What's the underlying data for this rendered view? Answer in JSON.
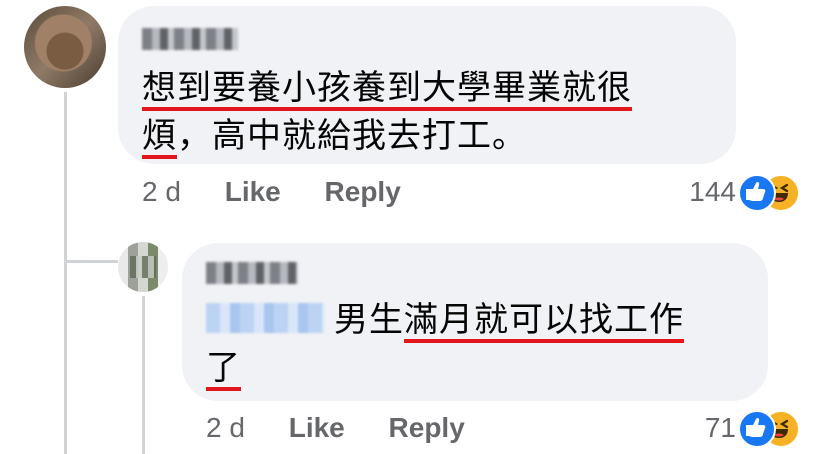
{
  "comments": [
    {
      "text_segments": [
        {
          "t": "想到要養小孩養到大學畢業就很",
          "u": true
        },
        {
          "t": "\n",
          "u": false
        },
        {
          "t": "煩",
          "u": true
        },
        {
          "t": "，高中就給我去打工。",
          "u": false
        }
      ],
      "time": "2 d",
      "like_label": "Like",
      "reply_label": "Reply",
      "reaction_count": "144"
    },
    {
      "text_segments": [
        {
          "t": "男生",
          "u": false
        },
        {
          "t": "滿月就可以找工作",
          "u": true
        },
        {
          "t": "\n",
          "u": false
        },
        {
          "t": "了",
          "u": true
        }
      ],
      "time": "2 d",
      "like_label": "Like",
      "reply_label": "Reply",
      "reaction_count": "71"
    }
  ],
  "reaction_icons": [
    "like-icon",
    "haha-icon"
  ],
  "colors": {
    "bubble": "#f0f2f5",
    "meta": "#65676b",
    "underline": "#e3161c",
    "like": "#1877f2",
    "haha": "#f7b125"
  }
}
